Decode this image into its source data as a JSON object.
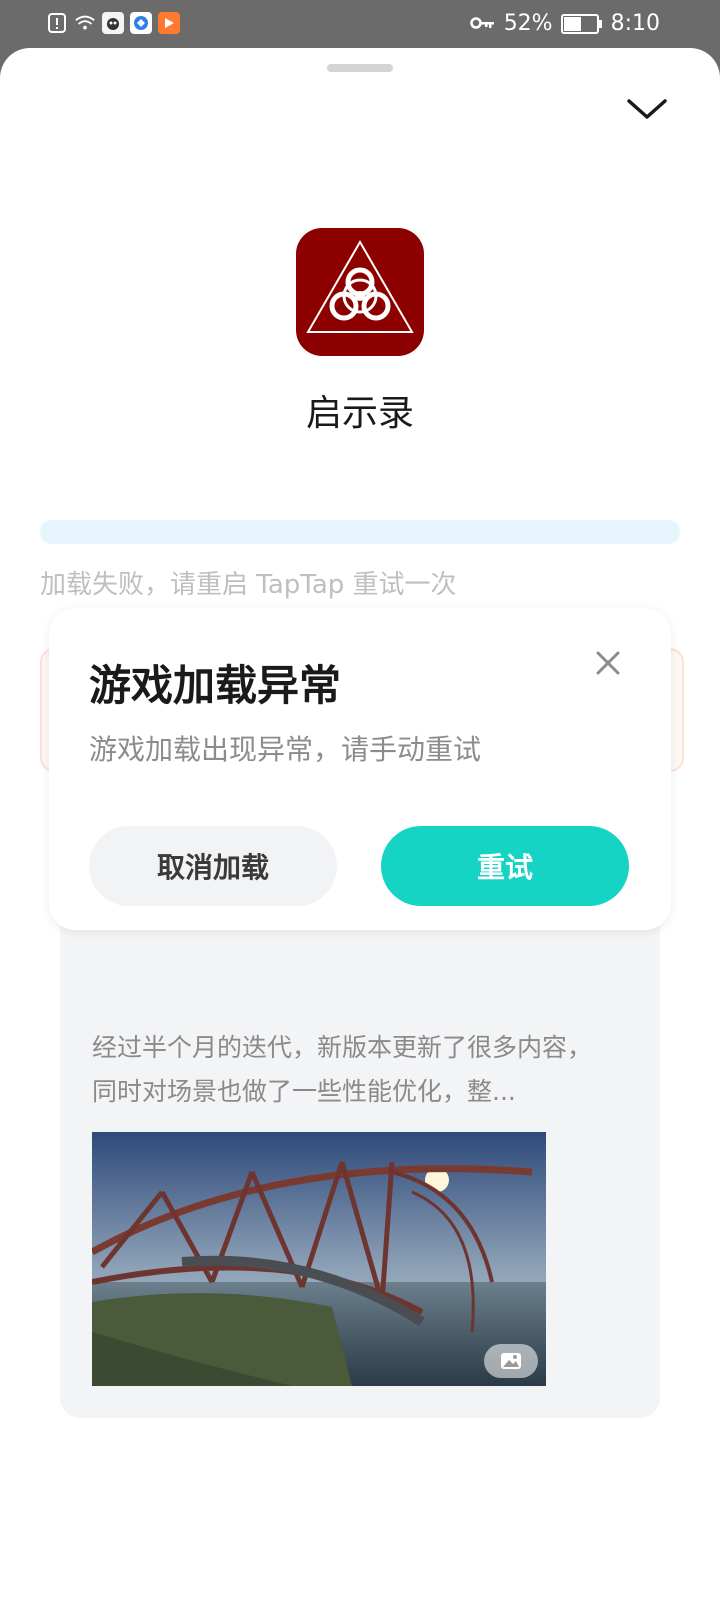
{
  "status_bar": {
    "battery_text": "52%",
    "battery_level": 0.52,
    "time": "8:10",
    "icons": [
      "sim-alert-icon",
      "wifi-icon",
      "app-notification-icon",
      "browser-icon",
      "video-app-icon",
      "key-icon",
      "battery-icon"
    ]
  },
  "game": {
    "name": "启示录",
    "icon": "biohazard-icon",
    "icon_color": "#8c0000"
  },
  "loading": {
    "error_text": "加载失败，请重启 TapTap 重试一次"
  },
  "card": {
    "excerpt": "经过半个月的迭代，新版本更新了很多内容，同时对场景也做了一些性能优化，整...",
    "image_badge_icon": "image-icon"
  },
  "dialog": {
    "title": "游戏加载异常",
    "message": "游戏加载出现异常，请手动重试",
    "cancel_label": "取消加载",
    "retry_label": "重试",
    "accent_color": "#15d4c4"
  }
}
